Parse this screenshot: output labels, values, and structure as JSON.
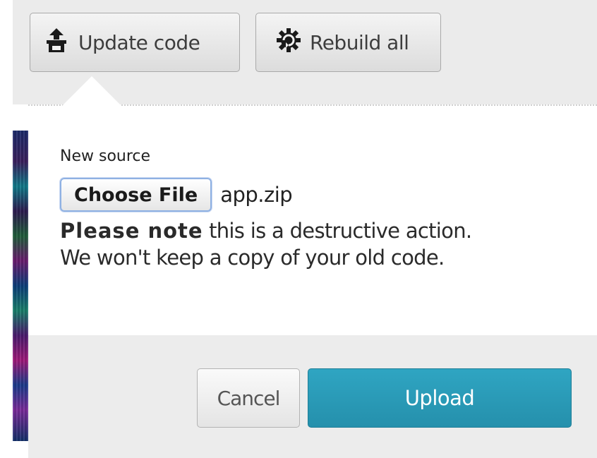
{
  "toolbar": {
    "update_code_label": "Update code",
    "update_code_icon": "upload-box-icon",
    "rebuild_all_label": "Rebuild all",
    "rebuild_all_icon": "gear-refresh-icon"
  },
  "popover": {
    "new_source_label": "New source",
    "choose_file_label": "Choose File",
    "selected_file": "app.zip",
    "note_bold": "Please note",
    "note_line1_rest": " this is a destructive action.",
    "note_line2": "We won't keep a copy of your old code."
  },
  "footer": {
    "cancel_label": "Cancel",
    "upload_label": "Upload"
  },
  "colors": {
    "upload_button": "#2a9bb8",
    "toolbar_bg": "#ebebeb",
    "footer_bg": "#ececec"
  }
}
